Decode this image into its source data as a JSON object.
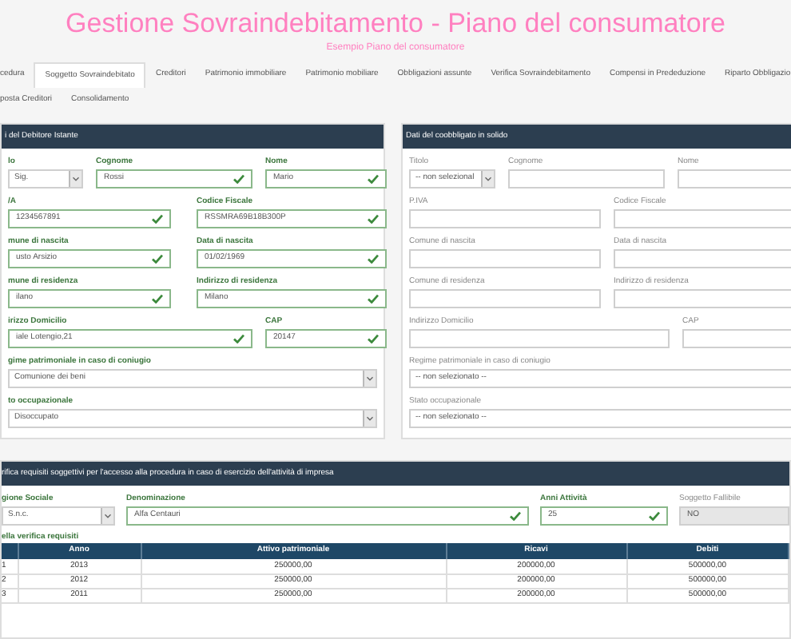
{
  "header": {
    "title": "Gestione Sovraindebitamento - Piano del consumatore",
    "subtitle": "Esempio Piano del consumatore"
  },
  "tab_rows": [
    [
      {
        "label": "cedura",
        "selected": false
      },
      {
        "label": "Soggetto Sovraindebitato",
        "selected": true
      },
      {
        "label": "Creditori",
        "selected": false
      },
      {
        "label": "Patrimonio immobiliare",
        "selected": false
      },
      {
        "label": "Patrimonio mobiliare",
        "selected": false
      },
      {
        "label": "Obbligazioni assunte",
        "selected": false
      },
      {
        "label": "Verifica Sovraindebitamento",
        "selected": false
      },
      {
        "label": "Compensi in Prededuzione",
        "selected": false
      },
      {
        "label": "Riparto Obbligazio",
        "selected": false
      }
    ],
    [
      {
        "label": "posta Creditori",
        "selected": false
      },
      {
        "label": "Consolidamento",
        "selected": false
      }
    ]
  ],
  "debtor_panel": {
    "title": "i del Debitore Istante",
    "rows": [
      [
        {
          "label": "lo",
          "kind": "select",
          "value": "Sig.",
          "valid": true
        },
        {
          "label": "Cognome",
          "kind": "text",
          "value": "Rossi",
          "valid": true
        },
        {
          "label": "Nome",
          "kind": "text",
          "value": "Mario",
          "valid": true
        }
      ],
      [
        {
          "label": "/A",
          "kind": "text",
          "value": "1234567891",
          "valid": true
        },
        {
          "label": "Codice Fiscale",
          "kind": "text",
          "value": "RSSMRA69B18B300P",
          "valid": true
        }
      ],
      [
        {
          "label": "mune di nascita",
          "kind": "text",
          "value": "usto Arsizio",
          "valid": true
        },
        {
          "label": "Data di nascita",
          "kind": "text",
          "value": "01/02/1969",
          "valid": true
        }
      ],
      [
        {
          "label": "mune di residenza",
          "kind": "text",
          "value": "ilano",
          "valid": true
        },
        {
          "label": "Indirizzo di residenza",
          "kind": "text",
          "value": "Milano",
          "valid": true
        }
      ],
      [
        {
          "label": "irizzo Domicilio",
          "kind": "text",
          "value": "iale Lotengio,21",
          "valid": true
        },
        {
          "label": "CAP",
          "kind": "text",
          "value": "20147",
          "valid": true
        }
      ],
      [
        {
          "label": "gime patrimoniale in caso di coniugio",
          "kind": "select",
          "value": "Comunione dei beni",
          "valid": true
        }
      ],
      [
        {
          "label": "to occupazionale",
          "kind": "select",
          "value": "Disoccupato",
          "valid": true
        }
      ]
    ]
  },
  "coobligor_panel": {
    "title": "Dati del coobbligato in solido",
    "rows": [
      [
        {
          "label": "Titolo",
          "kind": "select",
          "value": "-- non selezional",
          "valid": false
        },
        {
          "label": "Cognome",
          "kind": "text",
          "valid": false
        },
        {
          "label": "Nome",
          "kind": "text",
          "valid": false
        }
      ],
      [
        {
          "label": "P.IVA",
          "kind": "text",
          "valid": false
        },
        {
          "label": "Codice Fiscale",
          "kind": "text",
          "valid": false
        }
      ],
      [
        {
          "label": "Comune di nascita",
          "kind": "text",
          "valid": false
        },
        {
          "label": "Data di nascita",
          "kind": "text",
          "valid": false
        }
      ],
      [
        {
          "label": "Comune di residenza",
          "kind": "text",
          "valid": false
        },
        {
          "label": "Indirizzo di residenza",
          "kind": "text",
          "valid": false
        }
      ],
      [
        {
          "label": "Indirizzo Domicilio",
          "kind": "text",
          "valid": false
        },
        {
          "label": "CAP",
          "kind": "text",
          "valid": false
        }
      ],
      [
        {
          "label": "Regime patrimoniale in caso di coniugio",
          "kind": "select",
          "value": "-- non selezionato --",
          "valid": false
        }
      ],
      [
        {
          "label": "Stato occupazionale",
          "kind": "select",
          "value": "-- non selezionato --",
          "valid": false
        }
      ]
    ]
  },
  "verification_panel": {
    "title": "rifica requisiti soggettivi per l'accesso alla procedura in caso di esercizio dell'attività di impresa",
    "fields": [
      {
        "label": "gione Sociale",
        "kind": "select",
        "value": "S.n.c.",
        "valid": true,
        "disabled": false
      },
      {
        "label": "Denominazione",
        "kind": "text",
        "value": "Alfa Centauri",
        "valid": true,
        "disabled": false
      },
      {
        "label": "Anni Attività",
        "kind": "text",
        "value": "25",
        "valid": true,
        "disabled": false
      },
      {
        "label": "Soggetto Fallibile",
        "kind": "text",
        "value": "NO",
        "valid": false,
        "disabled": true
      }
    ],
    "table": {
      "caption": "ella verifica requisiti",
      "columns": [
        "",
        "Anno",
        "Attivo patrimoniale",
        "Ricavi",
        "Debiti"
      ],
      "rows": [
        [
          "1",
          "2013",
          "250000,00",
          "200000,00",
          "500000,00"
        ],
        [
          "2",
          "2012",
          "250000,00",
          "200000,00",
          "500000,00"
        ],
        [
          "3",
          "2011",
          "250000,00",
          "200000,00",
          "500000,00"
        ]
      ]
    }
  }
}
